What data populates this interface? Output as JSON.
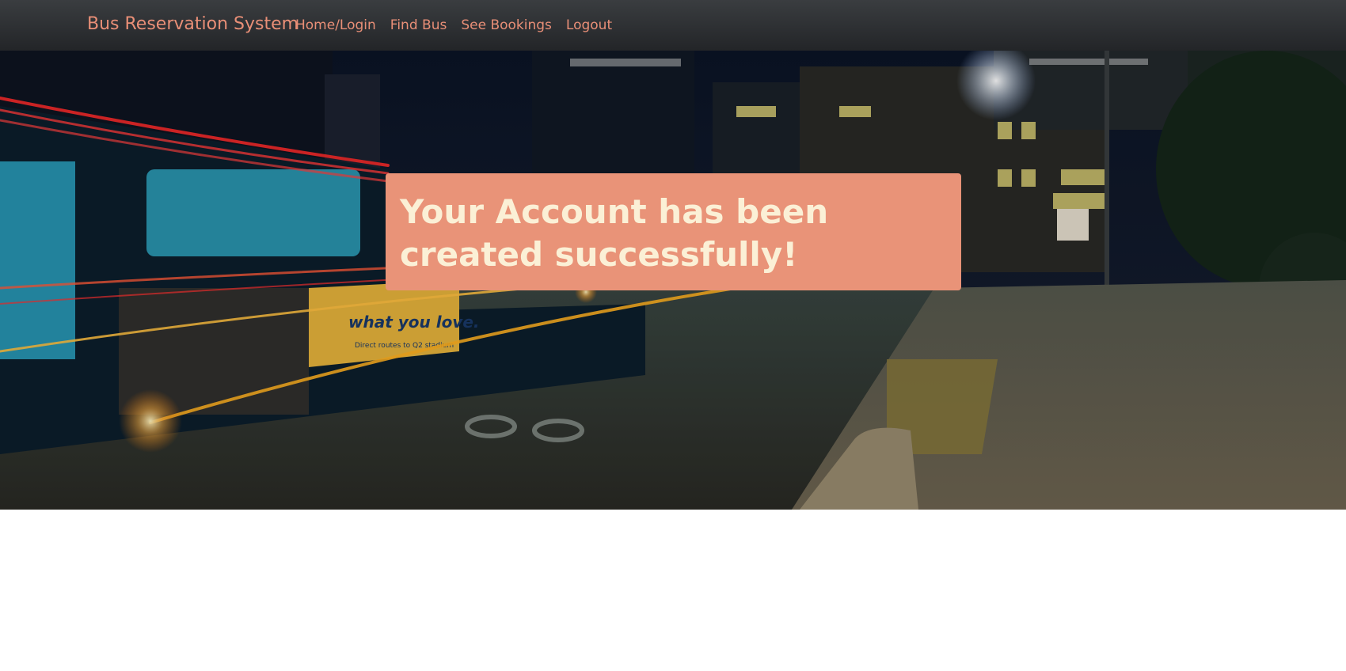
{
  "navbar": {
    "brand": "Bus Reservation System",
    "links": [
      {
        "label": "Home/Login"
      },
      {
        "label": "Find Bus"
      },
      {
        "label": "See Bookings"
      },
      {
        "label": "Logout"
      }
    ]
  },
  "hero": {
    "image_description_icon": "city-night-bus-photo",
    "alert_message": "Your Account has been created successfully!",
    "bus_ad_text": "what you love.",
    "bus_ad_subtext": "Direct routes to Q2 stadium"
  },
  "colors": {
    "nav_bg": "#2b2d30",
    "accent": "#e98f77",
    "alert_bg": "#e99378",
    "alert_text": "#fbf0d6"
  }
}
